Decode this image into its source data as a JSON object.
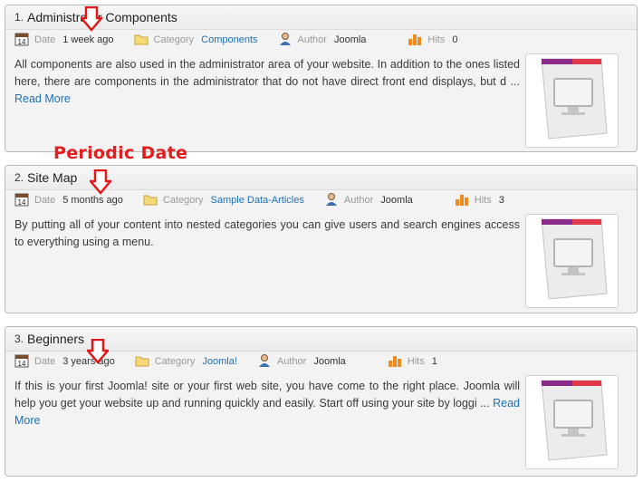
{
  "annotation": {
    "label": "Periodic Date"
  },
  "articles": [
    {
      "number": "1.",
      "title": "Administrator Components",
      "date_label": "Date",
      "date_value": "1 week ago",
      "category_label": "Category",
      "category_value": "Components",
      "author_label": "Author",
      "author_value": "Joomla",
      "hits_label": "Hits",
      "hits_value": "0",
      "body": "All components are also used in the administrator area of your website. In addition to the ones listed here, there are components in the administrator that do not have direct front end displays, but d",
      "ellipsis": "...",
      "read_more": "Read More"
    },
    {
      "number": "2.",
      "title": "Site Map",
      "date_label": "Date",
      "date_value": "5 months ago",
      "category_label": "Category",
      "category_value": "Sample Data-Articles",
      "author_label": "Author",
      "author_value": "Joomla",
      "hits_label": "Hits",
      "hits_value": "3",
      "body": "By putting all of your content into nested categories you can give users and search engines access to everything using a menu.",
      "ellipsis": "",
      "read_more": ""
    },
    {
      "number": "3.",
      "title": "Beginners",
      "date_label": "Date",
      "date_value": "3 years ago",
      "category_label": "Category",
      "category_value": "Joomla!",
      "author_label": "Author",
      "author_value": "Joomla",
      "hits_label": "Hits",
      "hits_value": "1",
      "body": "If this is your first Joomla! site or your first web site, you have come to the right place. Joomla will help you get your website up and running quickly and easily. Start off using your site by loggi",
      "ellipsis": "...",
      "read_more": "Read More"
    }
  ]
}
